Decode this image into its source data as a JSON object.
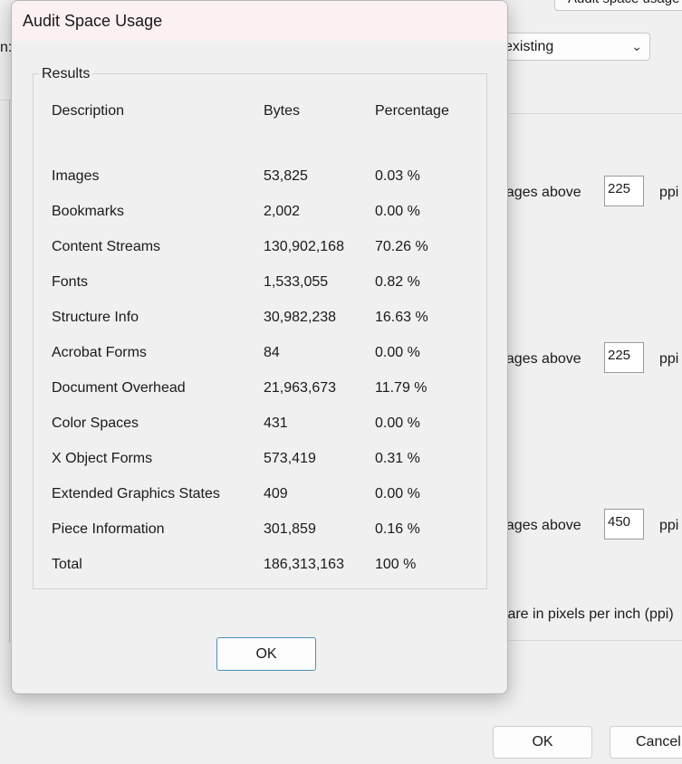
{
  "background": {
    "top_button_label": "Audit space usage",
    "left_label": "n:",
    "select_value": "existing",
    "rows": [
      {
        "label": "nages above",
        "value": "225",
        "unit": "ppi"
      },
      {
        "label": "nages above",
        "value": "225",
        "unit": "ppi"
      },
      {
        "label": "nages above",
        "value": "450",
        "unit": "ppi"
      }
    ],
    "note": "s are in pixels per inch (ppi)",
    "ok_label": "OK",
    "cancel_label": "Cancel"
  },
  "dialog": {
    "title": "Audit Space Usage",
    "group_label": "Results",
    "headers": {
      "description": "Description",
      "bytes": "Bytes",
      "percentage": "Percentage"
    },
    "rows": [
      {
        "description": "Images",
        "bytes": "53,825",
        "percentage": "0.03 %"
      },
      {
        "description": "Bookmarks",
        "bytes": "2,002",
        "percentage": "0.00 %"
      },
      {
        "description": "Content Streams",
        "bytes": "130,902,168",
        "percentage": "70.26 %"
      },
      {
        "description": "Fonts",
        "bytes": "1,533,055",
        "percentage": "0.82 %"
      },
      {
        "description": "Structure Info",
        "bytes": "30,982,238",
        "percentage": "16.63 %"
      },
      {
        "description": "Acrobat Forms",
        "bytes": "84",
        "percentage": "0.00 %"
      },
      {
        "description": "Document Overhead",
        "bytes": "21,963,673",
        "percentage": "11.79 %"
      },
      {
        "description": "Color Spaces",
        "bytes": "431",
        "percentage": "0.00 %"
      },
      {
        "description": "X Object Forms",
        "bytes": "573,419",
        "percentage": "0.31 %"
      },
      {
        "description": "Extended Graphics States",
        "bytes": "409",
        "percentage": "0.00 %"
      },
      {
        "description": "Piece Information",
        "bytes": "301,859",
        "percentage": "0.16 %"
      },
      {
        "description": "Total",
        "bytes": "186,313,163",
        "percentage": "100 %"
      }
    ],
    "ok_label": "OK"
  }
}
